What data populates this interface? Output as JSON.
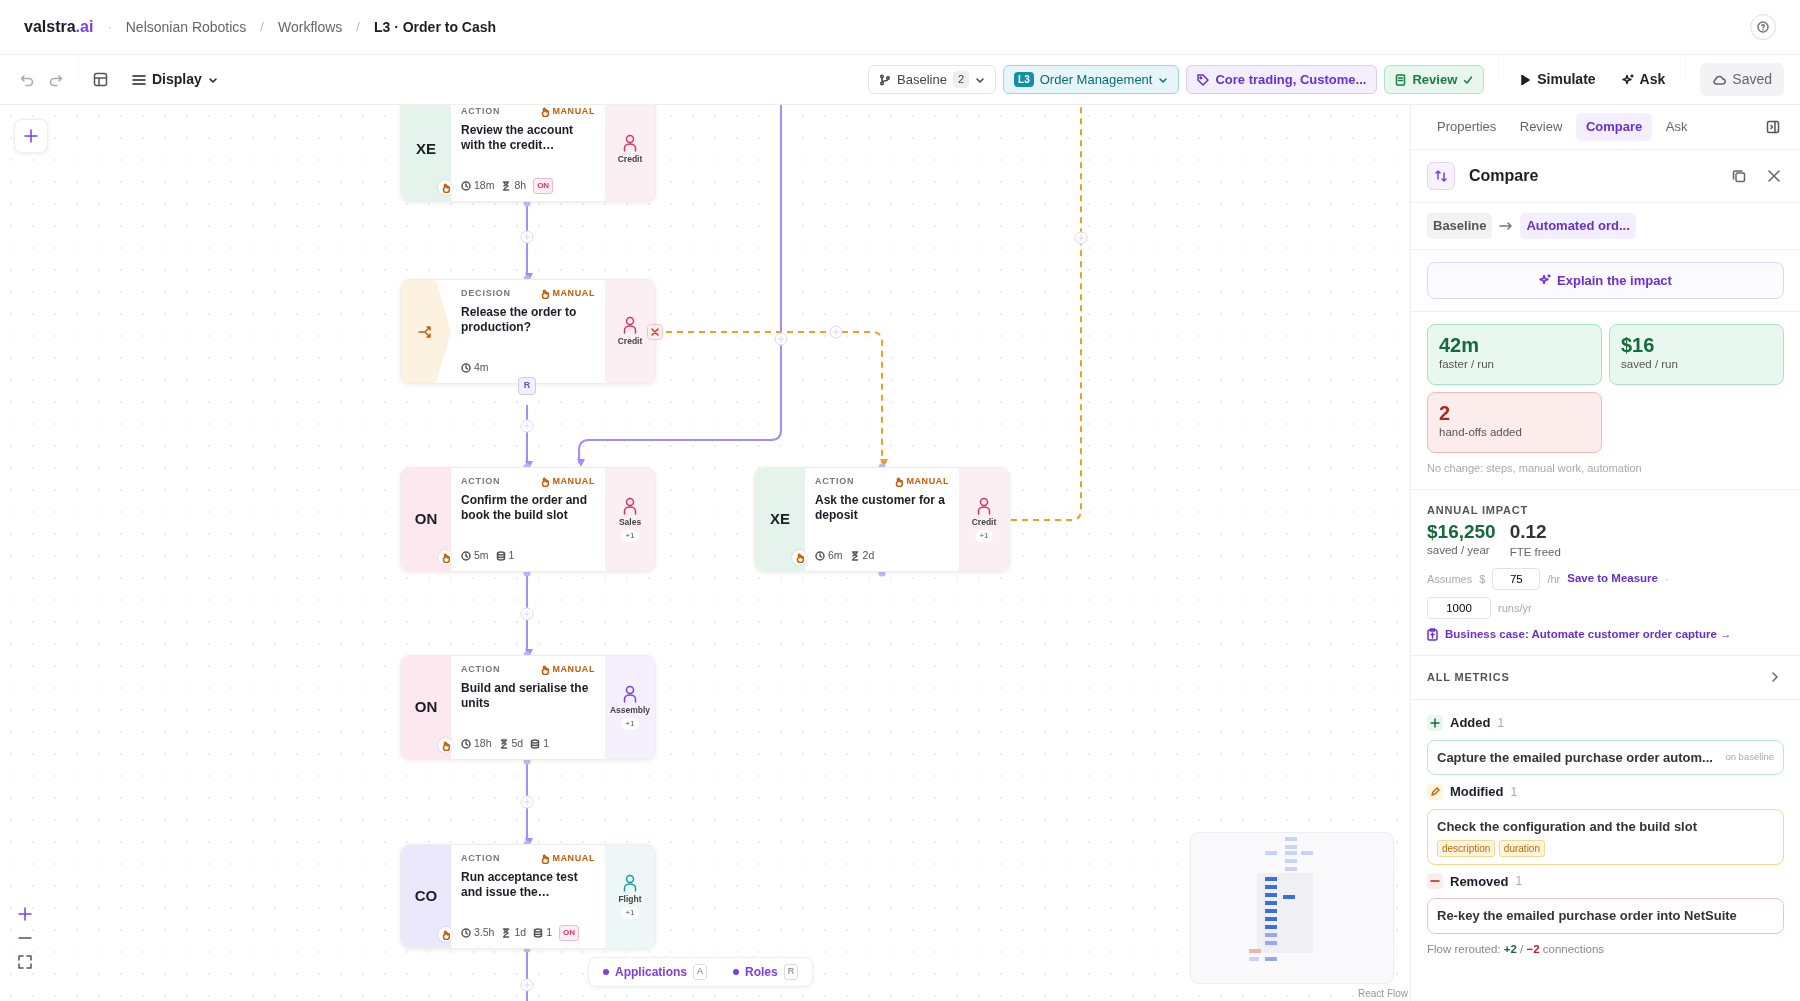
{
  "header": {
    "logo": "valstra",
    "logo_suffix": ".ai",
    "separator": "·",
    "breadcrumb": [
      {
        "label": "Nelsonian Robotics",
        "current": false
      },
      {
        "sep": "/",
        "label": "Workflows",
        "current": false
      },
      {
        "sep": "/",
        "label": "L3 · Order to Cash",
        "current": true
      }
    ]
  },
  "toolbar": {
    "display": "Display",
    "baseline": {
      "label": "Baseline",
      "count": "2"
    },
    "process": {
      "badge": "L3",
      "label": "Order Management"
    },
    "tags": "Core trading, Custome...",
    "review": "Review",
    "simulate": "Simulate",
    "ask": "Ask",
    "saved": "Saved"
  },
  "canvas": {
    "nodes": [
      {
        "kind": "action",
        "code": "XE",
        "color": "#e4f4ec",
        "type_label": "ACTION",
        "mode": "MANUAL",
        "title": "Review the account with the credit…",
        "metrics": [
          {
            "kind": "time",
            "text": "18m"
          },
          {
            "kind": "wait",
            "text": "8h"
          }
        ],
        "badge": "ON",
        "role": {
          "label": "Credit",
          "color": "#d6336c"
        }
      },
      {
        "kind": "decision",
        "color": "#fdf1e0",
        "type_label": "DECISION",
        "mode": "MANUAL",
        "title": "Release the order to production?",
        "metrics": [
          {
            "kind": "time",
            "text": "4m"
          }
        ],
        "role": {
          "label": "Credit",
          "color": "#d6336c"
        }
      },
      {
        "kind": "action",
        "code": "ON",
        "color": "#fce8ee",
        "type_label": "ACTION",
        "mode": "MANUAL",
        "title": "Confirm the order and book the build slot",
        "metrics": [
          {
            "kind": "time",
            "text": "5m"
          },
          {
            "kind": "data",
            "text": "1"
          }
        ],
        "role": {
          "label": "Sales",
          "color": "#d6336c",
          "extra": "+1"
        }
      },
      {
        "kind": "action",
        "code": "XE",
        "color": "#e4f4ec",
        "type_label": "ACTION",
        "mode": "MANUAL",
        "title": "Ask the customer for a deposit",
        "metrics": [
          {
            "kind": "time",
            "text": "6m"
          },
          {
            "kind": "wait",
            "text": "2d"
          }
        ],
        "role": {
          "label": "Credit",
          "color": "#d6336c",
          "extra": "+1"
        }
      },
      {
        "kind": "action",
        "code": "ON",
        "color": "#fce8ee",
        "type_label": "ACTION",
        "mode": "MANUAL",
        "title": "Build and serialise the units",
        "metrics": [
          {
            "kind": "time",
            "text": "18h"
          },
          {
            "kind": "wait",
            "text": "5d"
          },
          {
            "kind": "data",
            "text": "1"
          }
        ],
        "role": {
          "label": "Assembly",
          "color": "#7b3fe4",
          "extra": "+1"
        }
      },
      {
        "kind": "action",
        "code": "CO",
        "color": "#ebe8fb",
        "type_label": "ACTION",
        "mode": "MANUAL",
        "title": "Run acceptance test and issue the…",
        "metrics": [
          {
            "kind": "time",
            "text": "3.5h"
          },
          {
            "kind": "wait",
            "text": "1d"
          },
          {
            "kind": "data",
            "text": "1"
          }
        ],
        "badge": "ON",
        "role": {
          "label": "Flight",
          "color": "#1c9aa8",
          "extra": "+1"
        }
      }
    ],
    "decision_badge": "R",
    "legend": [
      {
        "label": "Applications",
        "key": "A"
      },
      {
        "label": "Roles",
        "key": "R"
      }
    ],
    "attribution": "React Flow"
  },
  "panel": {
    "tabs": [
      {
        "label": "Properties",
        "selected": false
      },
      {
        "label": "Review",
        "selected": false
      },
      {
        "label": "Compare",
        "selected": true
      },
      {
        "label": "Ask",
        "selected": false
      }
    ],
    "title": "Compare",
    "from": "Baseline",
    "to": "Automated ord...",
    "explain": "Explain the impact",
    "stats": [
      {
        "kind": "good",
        "value": "42m",
        "label": "faster / run"
      },
      {
        "kind": "good",
        "value": "$16",
        "label": "saved / run"
      },
      {
        "kind": "bad",
        "value": "2",
        "label": "hand-offs added"
      }
    ],
    "note": "No change: steps, manual work, automation",
    "annual": {
      "heading": "ANNUAL IMPACT",
      "values": [
        {
          "kind": "money",
          "value": "$16,250",
          "label": "saved / year"
        },
        {
          "kind": "plain",
          "value": "0.12",
          "label": "FTE freed"
        }
      ],
      "assumes": "Assumes",
      "currency": "$",
      "rate": "75",
      "rate_unit": "/hr",
      "save_link": "Save to Measure",
      "separator": "·",
      "runs": "1000",
      "runs_unit": "runs/yr",
      "business_case": "Business case: Automate customer order capture →"
    },
    "metrics_heading": "ALL METRICS",
    "changes": [
      {
        "kind": "added",
        "label": "Added",
        "count": "1",
        "items": [
          {
            "title": "Capture the emailed purchase order autom...",
            "note": "on baseline"
          }
        ]
      },
      {
        "kind": "modified",
        "label": "Modified",
        "count": "1",
        "items": [
          {
            "title": "Check the configuration and the build slot",
            "tags": [
              "description",
              "duration"
            ]
          }
        ]
      },
      {
        "kind": "removed",
        "label": "Removed",
        "count": "1",
        "items": [
          {
            "title": "Re-key the emailed purchase order into NetSuite"
          }
        ]
      }
    ],
    "reroute": {
      "prefix": "Flow rerouted:",
      "added": "+2",
      "sep": "/",
      "removed": "−2",
      "suffix": "connections"
    }
  }
}
